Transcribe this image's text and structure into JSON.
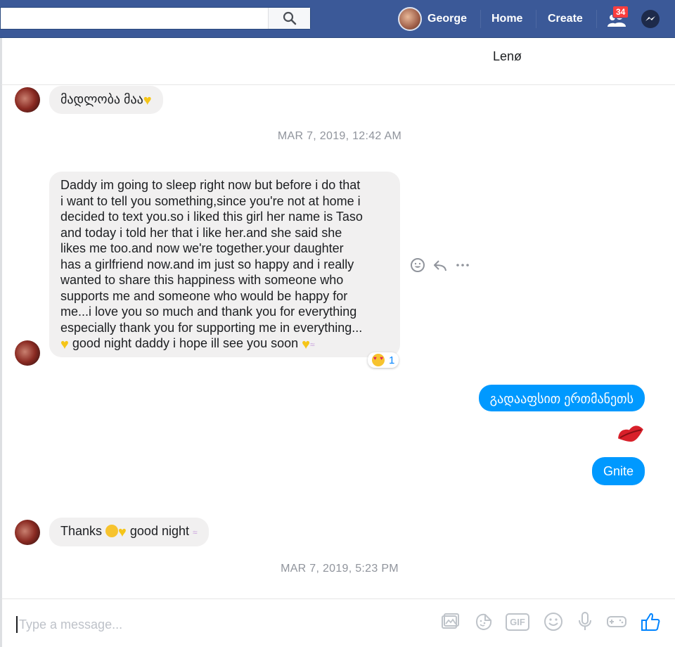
{
  "topbar": {
    "search_placeholder": "",
    "profile_name": "George",
    "home_label": "Home",
    "create_label": "Create",
    "notification_count": "34",
    "brand_color": "#3b5998"
  },
  "conversation": {
    "contact_name": "Lenø"
  },
  "messages": [
    {
      "id": "m1",
      "direction": "incoming",
      "text": "მადლობა მაა",
      "emoji_suffix": "yellow-heart"
    },
    {
      "id": "t1",
      "type": "timestamp",
      "text": "MAR 7, 2019, 12:42 AM"
    },
    {
      "id": "m2",
      "direction": "incoming",
      "lines": [
        "Daddy im going to sleep right now but before i do that",
        "i want to tell you something,since you're not at home i",
        "decided to text you.so i liked this girl her name is Taso",
        "and today i told her that i like her.and she said she",
        "likes me too.and now we're together.your daughter",
        "has a girlfriend now.and im just so happy and i really",
        "wanted to share this happiness with someone who",
        "supports me and someone who would be happy for",
        "me...i love you so much and thank you for everything",
        "especially thank you for supporting me in everything...",
        " good night daddy i hope ill see you soon "
      ],
      "reaction_count": "1"
    },
    {
      "id": "m3",
      "direction": "outgoing",
      "text": "გადააფსით ერთმანეთს"
    },
    {
      "id": "m4",
      "direction": "outgoing",
      "type": "emoji",
      "text": "kiss-lips"
    },
    {
      "id": "m5",
      "direction": "outgoing",
      "text": "Gnite"
    },
    {
      "id": "m6",
      "direction": "incoming",
      "text_before": "Thanks ",
      "text_after": " good night "
    },
    {
      "id": "t2",
      "type": "timestamp",
      "text": "MAR 7, 2019, 5:23 PM"
    }
  ],
  "composer": {
    "placeholder": "Type a message...",
    "tools": [
      "photo-icon",
      "sticker-icon",
      "gif-icon",
      "emoji-icon",
      "microphone-icon",
      "game-icon",
      "thumbs-up-icon"
    ],
    "gif_label": "GIF"
  },
  "colors": {
    "outgoing_bubble": "#0099ff",
    "incoming_bubble": "#f1f0f0",
    "accent": "#0084ff"
  }
}
